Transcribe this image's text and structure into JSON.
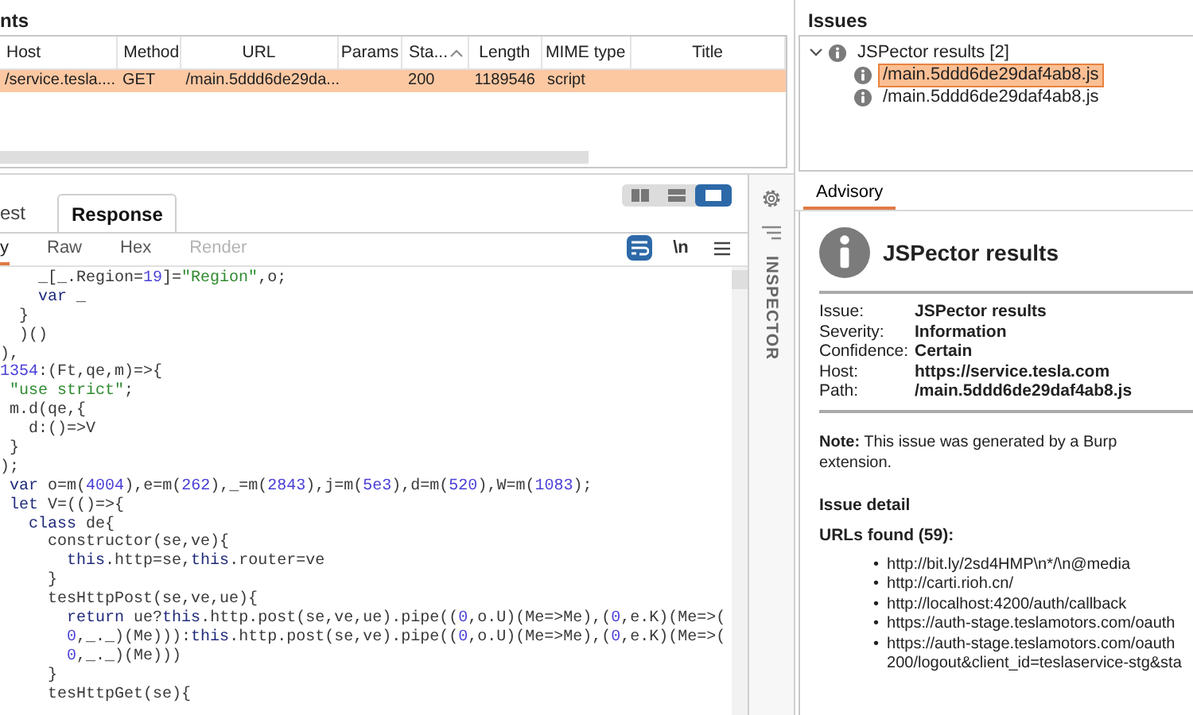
{
  "requests": {
    "title": "nts",
    "columns": [
      {
        "label": "Host",
        "sorted": false
      },
      {
        "label": "Method",
        "sorted": false
      },
      {
        "label": "URL",
        "sorted": false
      },
      {
        "label": "Params",
        "sorted": false
      },
      {
        "label": "Sta...",
        "sorted": true
      },
      {
        "label": "Length",
        "sorted": false
      },
      {
        "label": "MIME type",
        "sorted": false
      },
      {
        "label": "Title",
        "sorted": false
      }
    ],
    "rows": [
      {
        "selected": true,
        "cells": [
          "/service.tesla....",
          "GET",
          "/main.5ddd6de29da...",
          null,
          "200",
          "1189546",
          "script",
          null
        ]
      }
    ]
  },
  "editor": {
    "tabs": [
      {
        "label": "est",
        "selected": false
      },
      {
        "label": "Response",
        "selected": true
      }
    ],
    "view_modes": [
      {
        "kind": "columns",
        "selected": false
      },
      {
        "kind": "rows",
        "selected": false
      },
      {
        "kind": "single",
        "selected": true
      }
    ],
    "view_tabs": [
      {
        "label": "y",
        "selected": true,
        "disabled": false
      },
      {
        "label": "Raw",
        "selected": false,
        "disabled": false
      },
      {
        "label": "Hex",
        "selected": false,
        "disabled": false
      },
      {
        "label": "Render",
        "selected": false,
        "disabled": true
      }
    ],
    "tools": [
      {
        "kind": "wrap",
        "selected": true
      },
      {
        "kind": "newline",
        "label": "\\n",
        "selected": false
      },
      {
        "kind": "menu",
        "selected": false
      }
    ],
    "code": [
      "    _[_.Region=19]=\"Region\",o;",
      "    var _",
      "  }",
      "  )()",
      "),",
      "1354:(Ft,qe,m)=>{",
      " \"use strict\";",
      " m.d(qe,{",
      "   d:()=>V",
      " }",
      ");",
      " var o=m(4004),e=m(262),_=m(2843),j=m(5e3),d=m(520),W=m(1083);",
      " let V=(()=>{",
      "   class de{",
      "     constructor(se,ve){",
      "       this.http=se,this.router=ve",
      "     }",
      "     tesHttpPost(se,ve,ue){",
      "       return ue?this.http.post(se,ve,ue).pipe((0,o.U)(Me=>Me),(0,e.K)(Me=>(",
      "       0,_._)(Me))):this.http.post(se,ve).pipe((0,o.U)(Me=>Me),(0,e.K)(Me=>(",
      "       0,_._)(Me)))",
      "     }",
      "     tesHttpGet(se){"
    ]
  },
  "inspector": {
    "label": "INSPECTOR"
  },
  "issues": {
    "title": "Issues",
    "tree": [
      {
        "label": "JSPector results [2]",
        "expanded": true,
        "children": [
          {
            "label": "/main.5ddd6de29daf4ab8.js",
            "selected": true
          },
          {
            "label": "/main.5ddd6de29daf4ab8.js",
            "selected": false
          }
        ]
      }
    ]
  },
  "advisory": {
    "tabs": [
      {
        "label": "Advisory",
        "selected": true
      }
    ],
    "title": "JSPector results",
    "fields": [
      {
        "label": "Issue:",
        "value": "JSPector results"
      },
      {
        "label": "Severity:",
        "value": "Information"
      },
      {
        "label": "Confidence:",
        "value": "Certain"
      },
      {
        "label": "Host:",
        "value": "https://service.tesla.com"
      },
      {
        "label": "Path:",
        "value": "/main.5ddd6de29daf4ab8.js"
      }
    ],
    "note": "**Note:** This issue was generated by a Burp extension.",
    "detail_heading": "Issue detail",
    "urls_heading": "URLs found (59):",
    "urls": [
      {
        "bullet": "•",
        "lines": [
          "http://bit.ly/2sd4HMP\\n*/\\n@media"
        ]
      },
      {
        "bullet": "•",
        "lines": [
          "http://carti.rioh.cn/"
        ]
      },
      {
        "bullet": "•",
        "lines": [
          "http://localhost:4200/auth/callback"
        ]
      },
      {
        "bullet": "•",
        "lines": [
          "https://auth-stage.teslamotors.com/oauth"
        ]
      },
      {
        "bullet": "•",
        "lines": [
          "https://auth-stage.teslamotors.com/oauth",
          "200/logout&client_id=teslaservice-stg&sta"
        ]
      }
    ]
  }
}
